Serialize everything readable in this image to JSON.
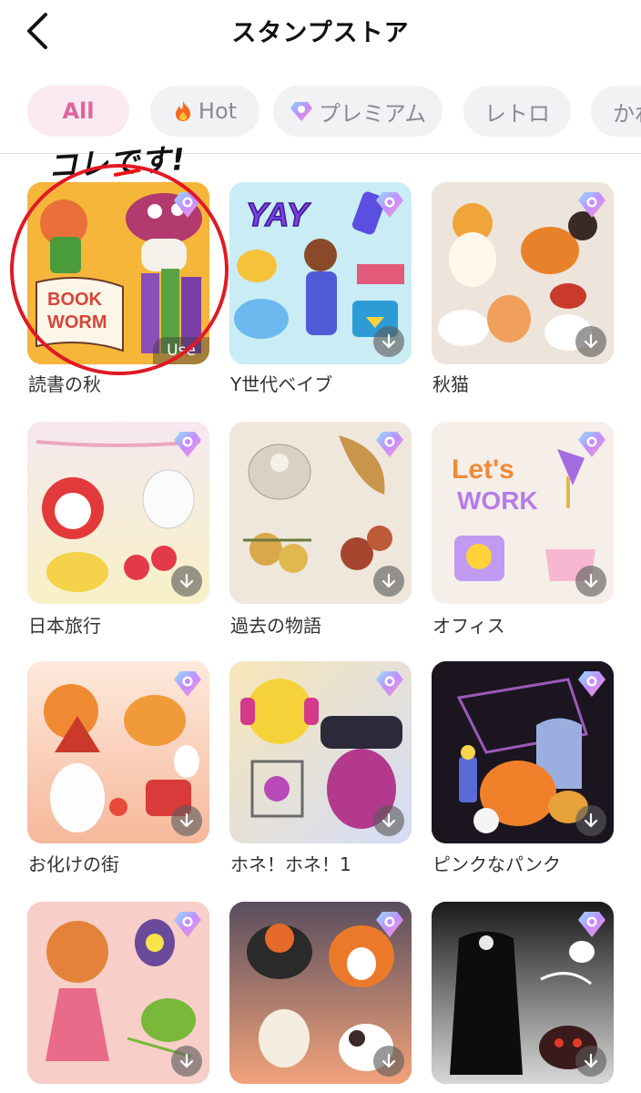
{
  "header": {
    "title": "スタンプストア",
    "back_icon": "chevron-left-icon"
  },
  "tabs": [
    {
      "label": "All",
      "active": true
    },
    {
      "label": "Hot",
      "icon": "fire-icon"
    },
    {
      "label": "プレミアム",
      "icon": "premium-gem-icon"
    },
    {
      "label": "レトロ"
    },
    {
      "label": "かわ"
    }
  ],
  "annotation": {
    "text": "コレです!",
    "color": "#e11925"
  },
  "badge": {
    "use_label": "Use"
  },
  "packs": [
    {
      "name": "読書の秋",
      "status": "use",
      "bg": "#f6b63a",
      "art_text": "BOOK WORM"
    },
    {
      "name": "Y世代ベイブ",
      "status": "download",
      "bg": "#c9ecf5",
      "art_text": "YAY"
    },
    {
      "name": "秋猫",
      "status": "download",
      "bg": "#ede4db"
    },
    {
      "name": "日本旅行",
      "status": "download",
      "bg": "#f7e3ec"
    },
    {
      "name": "過去の物語",
      "status": "download",
      "bg": "#efe7dc"
    },
    {
      "name": "オフィス",
      "status": "download",
      "bg": "#f6eee9",
      "art_text": "Let's WORK"
    },
    {
      "name": "お化けの街",
      "status": "download",
      "bg": "#fbd9c8"
    },
    {
      "name": "ホネ！ホネ！1",
      "status": "download",
      "bg": "#dfe6f7"
    },
    {
      "name": "ピンクなパンク",
      "status": "download",
      "bg": "#1b1520"
    },
    {
      "name": "",
      "status": "download",
      "bg": "#f7cfc8"
    },
    {
      "name": "",
      "status": "download",
      "bg": "#8d7d88"
    },
    {
      "name": "",
      "status": "download",
      "bg": "#2a2a2a"
    }
  ]
}
